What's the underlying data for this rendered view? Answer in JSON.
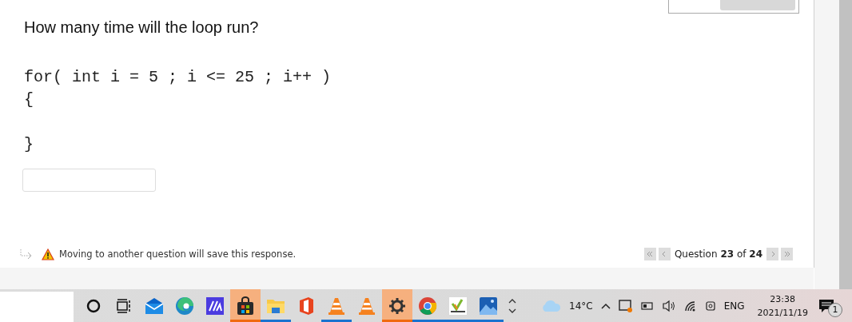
{
  "question": {
    "prompt": "How many time will the loop run?",
    "code_lines": [
      "for( int i = 5 ; i <= 25 ; i++ )",
      "{",
      "}"
    ],
    "notice": "Moving to another question will save this response.",
    "navigation": {
      "label": "Question **23** of **24**"
    }
  },
  "taskbar": {
    "apps": [
      {
        "kind": "cortana",
        "running": false,
        "flashing": false
      },
      {
        "kind": "taskview",
        "running": false,
        "flashing": false
      },
      {
        "kind": "mail",
        "running": false,
        "flashing": false
      },
      {
        "kind": "edge",
        "running": false,
        "flashing": false
      },
      {
        "kind": "ma",
        "running": false,
        "flashing": false
      },
      {
        "kind": "store",
        "running": true,
        "flashing": true
      },
      {
        "kind": "explorer",
        "running": true,
        "flashing": false
      },
      {
        "kind": "office",
        "running": false,
        "flashing": false
      },
      {
        "kind": "cone",
        "running": true,
        "flashing": false
      },
      {
        "kind": "cone",
        "running": false,
        "flashing": false
      },
      {
        "kind": "settings",
        "running": true,
        "flashing": true
      },
      {
        "kind": "chrome",
        "running": true,
        "flashing": false
      },
      {
        "kind": "check",
        "running": true,
        "flashing": false
      },
      {
        "kind": "photos",
        "running": true,
        "flashing": false
      }
    ],
    "temperature": "14°C",
    "language": "ENG",
    "time": "23:38",
    "date": "2021/11/19",
    "notification_count": "1"
  }
}
